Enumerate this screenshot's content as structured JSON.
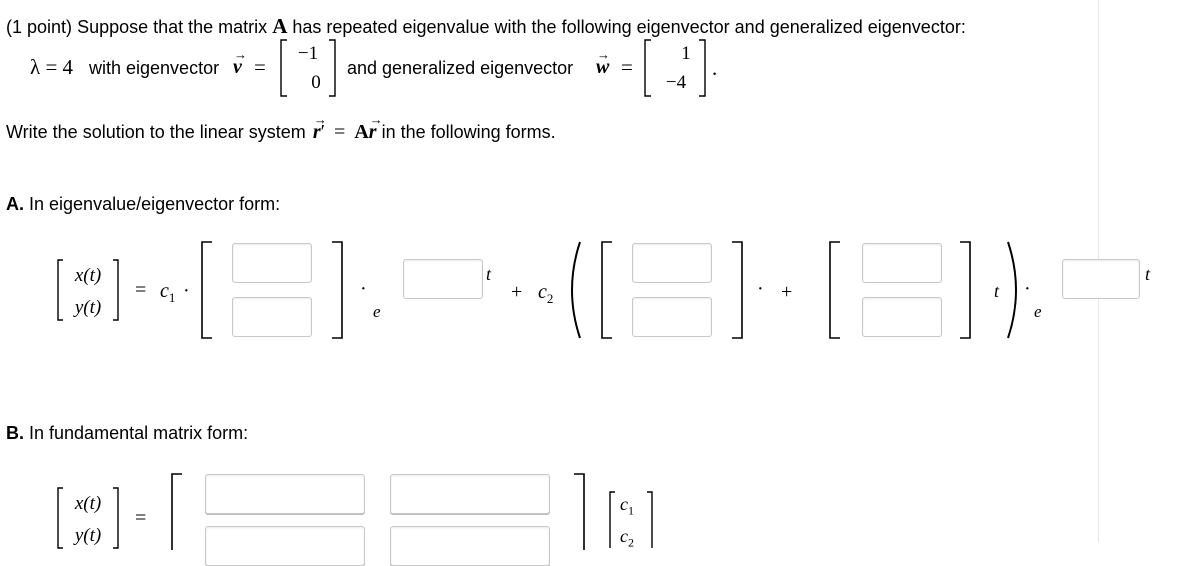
{
  "problem": {
    "points": "(1 point)",
    "intro": "Suppose that the matrix",
    "matrix_symbol": "A",
    "intro_rest": "has repeated eigenvalue with the following eigenvector and generalized eigenvector:",
    "lambda_symbol": "λ",
    "equals": "=",
    "lambda_value": "4",
    "with_eigenvector": "with eigenvector",
    "v_symbol": "v",
    "v": [
      "−1",
      "0"
    ],
    "and_generalized": "and generalized eigenvector",
    "w_symbol": "w",
    "w": [
      "1",
      "−4"
    ],
    "period": ".",
    "write_solution": "Write the solution to the linear system",
    "r_symbol": "r",
    "prime": "′",
    "A_symbol": "A",
    "following_forms": "in the following forms."
  },
  "part_a": {
    "label": "A.",
    "title": "In eigenvalue/eigenvector form:",
    "x_t": "x(t)",
    "y_t": "y(t)",
    "equals": "=",
    "c1": "c",
    "c1_sub": "1",
    "c2": "c",
    "c2_sub": "2",
    "e": "e",
    "t": "t",
    "plus": "+",
    "dot": "·"
  },
  "part_b": {
    "label": "B.",
    "title": "In fundamental matrix form:",
    "x_t": "x(t)",
    "y_t": "y(t)",
    "equals": "=",
    "c1": "c",
    "c1_sub": "1",
    "c2": "c",
    "c2_sub": "2"
  }
}
